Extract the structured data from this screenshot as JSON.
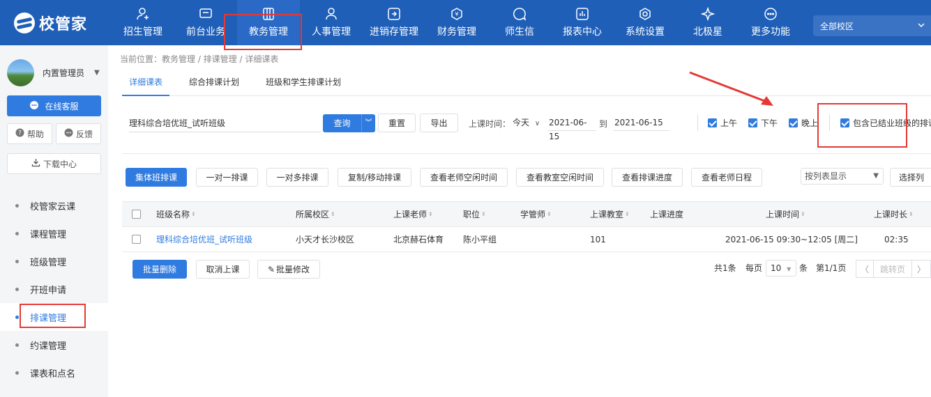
{
  "app": {
    "logo_text": "校管家"
  },
  "nav": [
    {
      "label": "招生管理",
      "icon": "user-add-icon"
    },
    {
      "label": "前台业务",
      "icon": "monitor-icon"
    },
    {
      "label": "教务管理",
      "icon": "book-icon",
      "active": true
    },
    {
      "label": "人事管理",
      "icon": "person-icon"
    },
    {
      "label": "进销存管理",
      "icon": "inventory-icon"
    },
    {
      "label": "财务管理",
      "icon": "finance-icon"
    },
    {
      "label": "师生信",
      "icon": "chat-icon"
    },
    {
      "label": "报表中心",
      "icon": "report-icon"
    },
    {
      "label": "系统设置",
      "icon": "gear-icon"
    },
    {
      "label": "北极星",
      "icon": "star-icon"
    },
    {
      "label": "更多功能",
      "icon": "more-icon"
    }
  ],
  "campus_select": {
    "value": "全部校区"
  },
  "sidebar": {
    "user_name": "内置管理员",
    "service_btn": "在线客服",
    "help_btn": "帮助",
    "feedback_btn": "反馈",
    "download_btn": "下载中心",
    "menu": [
      {
        "label": "校管家云课"
      },
      {
        "label": "课程管理"
      },
      {
        "label": "班级管理"
      },
      {
        "label": "开班申请"
      },
      {
        "label": "排课管理",
        "active": true
      },
      {
        "label": "约课管理"
      },
      {
        "label": "课表和点名"
      }
    ]
  },
  "breadcrumb": "当前位置：教务管理 / 排课管理 / 详细课表",
  "tabs": [
    "详细课表",
    "综合排课计划",
    "班级和学生排课计划"
  ],
  "filters": {
    "search_value": "理科综合培优班_试听班级",
    "query_btn": "查询",
    "reset_btn": "重置",
    "export_btn": "导出",
    "time_label": "上课时间：",
    "time_range": "今天",
    "date_from": "2021-06-15",
    "to_label": "到",
    "date_to": "2021-06-15",
    "morning": "上午",
    "afternoon": "下午",
    "evening": "晚上",
    "include_graduated": "包含已结业班级的排课"
  },
  "actions": {
    "group_schedule": "集体班排课",
    "one_to_one": "一对一排课",
    "one_to_many": "一对多排课",
    "copy_move": "复制/移动排课",
    "teacher_free": "查看老师空闲时间",
    "room_free": "查看教室空闲时间",
    "progress": "查看排课进度",
    "teacher_schedule": "查看老师日程",
    "view_mode": "按列表显示",
    "choose_cols": "选择列"
  },
  "table": {
    "headers": {
      "class_name": "班级名称",
      "campus": "所属校区",
      "teacher": "上课老师",
      "position": "职位",
      "manager": "学管师",
      "room": "上课教室",
      "progress": "上课进度",
      "time": "上课时间",
      "duration": "上课时长"
    },
    "rows": [
      {
        "class_name": "理科综合培优班_试听班级",
        "campus": "小天才长沙校区",
        "teacher": "北京赫石体育",
        "position": "陈小平组",
        "manager": "",
        "room": "101",
        "progress": "",
        "time": "2021-06-15 09:30~12:05 [周二]",
        "duration": "02:35"
      }
    ]
  },
  "footer": {
    "batch_delete": "批量删除",
    "cancel_class": "取消上课",
    "batch_edit": "批量修改",
    "total": "共1条",
    "per_page_label": "每页",
    "per_page": "10",
    "unit": "条",
    "page_info": "第1/1页",
    "jump": "跳转页"
  },
  "colors": {
    "primary": "#2f7be0",
    "nav_bg": "#1f5fb8",
    "highlight": "#e53935"
  }
}
